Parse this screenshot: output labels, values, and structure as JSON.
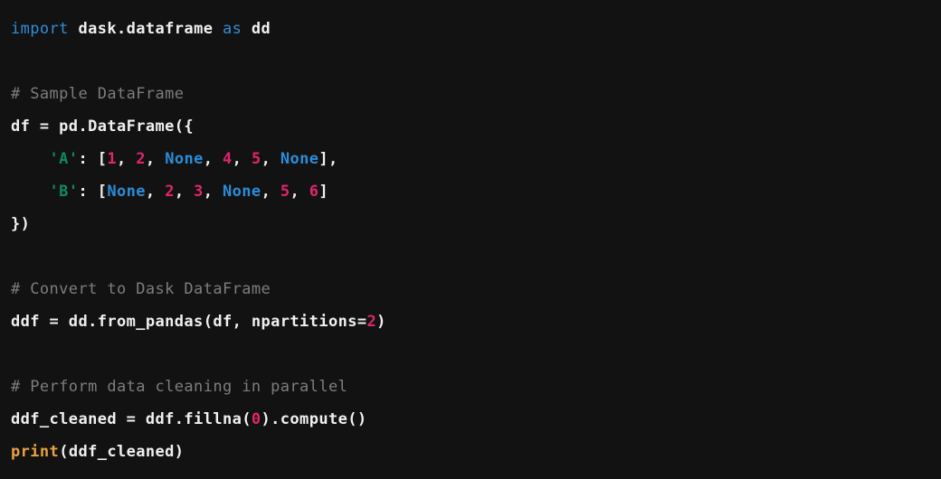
{
  "editor": {
    "background_color": "#121212",
    "language": "python",
    "theme_colors": {
      "default_text": "#f0f0f0",
      "keyword": "#2f8fd9",
      "constant": "#2b8cd8",
      "string": "#0e8a5f",
      "number": "#e0256e",
      "comment": "#7d7d7d",
      "builtin": "#e8a33d"
    }
  },
  "code": {
    "lines": [
      {
        "index": 1,
        "text": "import dask.dataframe as dd",
        "tokens": [
          {
            "text": "import",
            "type": "keyword"
          },
          {
            "text": " dask.dataframe ",
            "type": "plain"
          },
          {
            "text": "as",
            "type": "keyword"
          },
          {
            "text": " dd",
            "type": "plain"
          }
        ]
      },
      {
        "index": 2,
        "text": "",
        "tokens": []
      },
      {
        "index": 3,
        "text": "# Sample DataFrame",
        "tokens": [
          {
            "text": "# Sample DataFrame",
            "type": "comment"
          }
        ]
      },
      {
        "index": 4,
        "text": "df = pd.DataFrame({",
        "tokens": [
          {
            "text": "df = pd.DataFrame({",
            "type": "plain"
          }
        ]
      },
      {
        "index": 5,
        "text": "    'A': [1, 2, None, 4, 5, None],",
        "tokens": [
          {
            "text": "    ",
            "type": "plain"
          },
          {
            "text": "'A'",
            "type": "string"
          },
          {
            "text": ": [",
            "type": "plain"
          },
          {
            "text": "1",
            "type": "number"
          },
          {
            "text": ", ",
            "type": "plain"
          },
          {
            "text": "2",
            "type": "number"
          },
          {
            "text": ", ",
            "type": "plain"
          },
          {
            "text": "None",
            "type": "const"
          },
          {
            "text": ", ",
            "type": "plain"
          },
          {
            "text": "4",
            "type": "number"
          },
          {
            "text": ", ",
            "type": "plain"
          },
          {
            "text": "5",
            "type": "number"
          },
          {
            "text": ", ",
            "type": "plain"
          },
          {
            "text": "None",
            "type": "const"
          },
          {
            "text": "],",
            "type": "plain"
          }
        ]
      },
      {
        "index": 6,
        "text": "    'B': [None, 2, 3, None, 5, 6]",
        "tokens": [
          {
            "text": "    ",
            "type": "plain"
          },
          {
            "text": "'B'",
            "type": "string"
          },
          {
            "text": ": [",
            "type": "plain"
          },
          {
            "text": "None",
            "type": "const"
          },
          {
            "text": ", ",
            "type": "plain"
          },
          {
            "text": "2",
            "type": "number"
          },
          {
            "text": ", ",
            "type": "plain"
          },
          {
            "text": "3",
            "type": "number"
          },
          {
            "text": ", ",
            "type": "plain"
          },
          {
            "text": "None",
            "type": "const"
          },
          {
            "text": ", ",
            "type": "plain"
          },
          {
            "text": "5",
            "type": "number"
          },
          {
            "text": ", ",
            "type": "plain"
          },
          {
            "text": "6",
            "type": "number"
          },
          {
            "text": "]",
            "type": "plain"
          }
        ]
      },
      {
        "index": 7,
        "text": "})",
        "tokens": [
          {
            "text": "})",
            "type": "plain"
          }
        ]
      },
      {
        "index": 8,
        "text": "",
        "tokens": []
      },
      {
        "index": 9,
        "text": "# Convert to Dask DataFrame",
        "tokens": [
          {
            "text": "# Convert to Dask DataFrame",
            "type": "comment"
          }
        ]
      },
      {
        "index": 10,
        "text": "ddf = dd.from_pandas(df, npartitions=2)",
        "tokens": [
          {
            "text": "ddf = dd.from_pandas(df, npartitions=",
            "type": "plain"
          },
          {
            "text": "2",
            "type": "number"
          },
          {
            "text": ")",
            "type": "plain"
          }
        ]
      },
      {
        "index": 11,
        "text": "",
        "tokens": []
      },
      {
        "index": 12,
        "text": "# Perform data cleaning in parallel",
        "tokens": [
          {
            "text": "# Perform data cleaning in parallel",
            "type": "comment"
          }
        ]
      },
      {
        "index": 13,
        "text": "ddf_cleaned = ddf.fillna(0).compute()",
        "tokens": [
          {
            "text": "ddf_cleaned = ddf.fillna(",
            "type": "plain"
          },
          {
            "text": "0",
            "type": "number"
          },
          {
            "text": ").compute()",
            "type": "plain"
          }
        ]
      },
      {
        "index": 14,
        "text": "print(ddf_cleaned)",
        "tokens": [
          {
            "text": "print",
            "type": "builtin"
          },
          {
            "text": "(ddf_cleaned)",
            "type": "plain"
          }
        ]
      }
    ]
  }
}
